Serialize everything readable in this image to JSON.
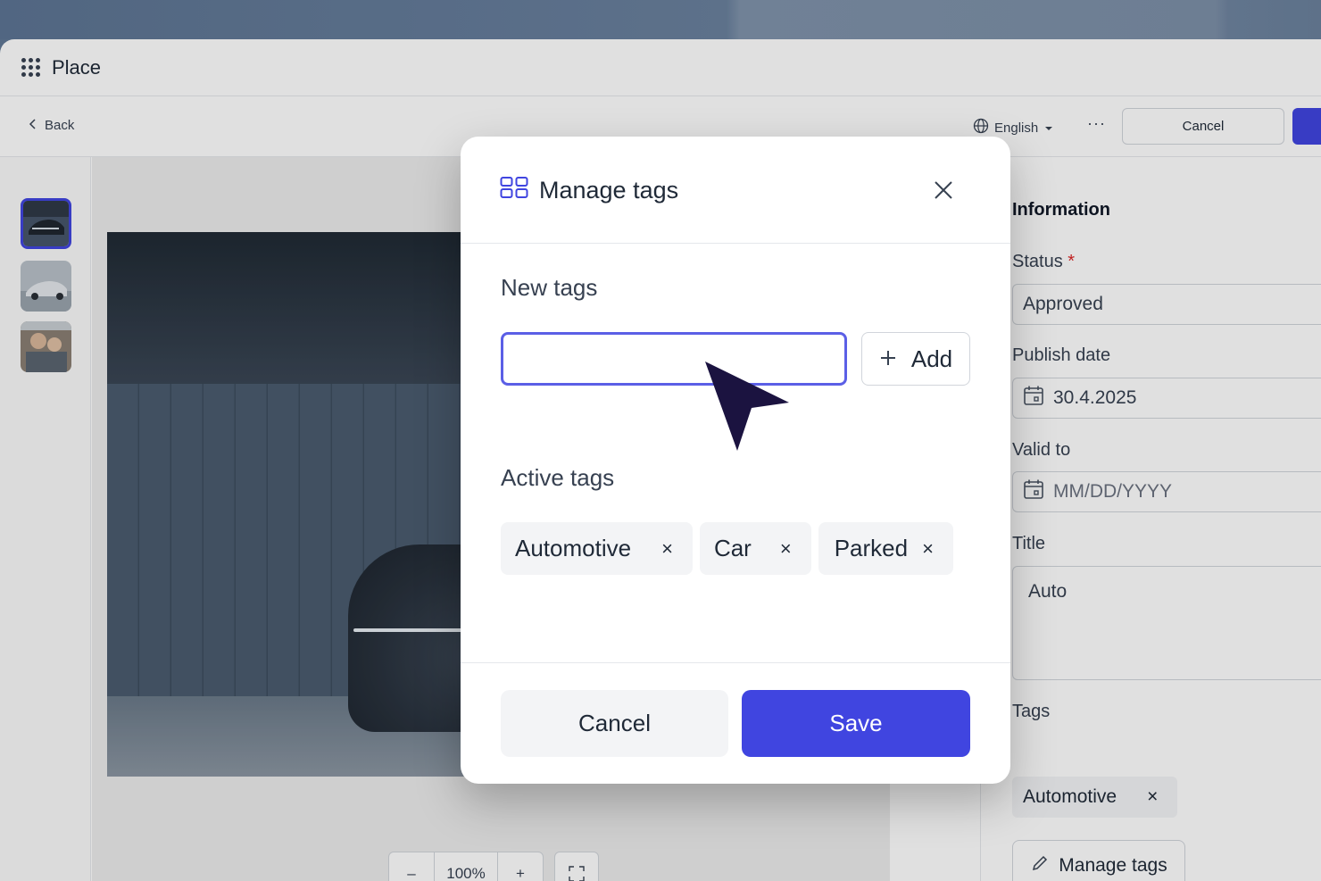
{
  "app": {
    "title": "Place"
  },
  "toolbar": {
    "back_label": "Back",
    "language": "English",
    "more": "···",
    "cancel_label": "Cancel"
  },
  "viewer": {
    "zoom_minus": "–",
    "zoom_value": "100%",
    "zoom_plus": "+"
  },
  "panel": {
    "heading": "Information",
    "status_label": "Status",
    "required_mark": "*",
    "status_value": "Approved",
    "publish_label": "Publish date",
    "publish_value": "30.4.2025",
    "valid_label": "Valid to",
    "valid_placeholder": "MM/DD/YYYY",
    "title_label": "Title",
    "title_value": "Auto",
    "tags_label": "Tags",
    "tags": [
      "Automotive"
    ],
    "tag_remove": "×",
    "manage_label": "Manage tags"
  },
  "modal": {
    "title": "Manage tags",
    "new_tags_label": "New tags",
    "input_value": "",
    "add_label": "Add",
    "active_tags_label": "Active tags",
    "active_tags": [
      "Automotive",
      "Car",
      "Parked"
    ],
    "tag_remove": "×",
    "cancel_label": "Cancel",
    "save_label": "Save"
  },
  "colors": {
    "accent": "#4045e0",
    "focus": "#5b5fe6",
    "required": "#dc2626",
    "cursor": "#1b1340"
  },
  "icons": [
    "apps-grid-icon",
    "chevron-left-icon",
    "globe-icon",
    "caret-down-icon",
    "more-icon",
    "fullscreen-icon",
    "calendar-icon",
    "pencil-icon",
    "tag-layout-icon",
    "close-icon",
    "plus-icon",
    "cursor-arrow-icon"
  ]
}
